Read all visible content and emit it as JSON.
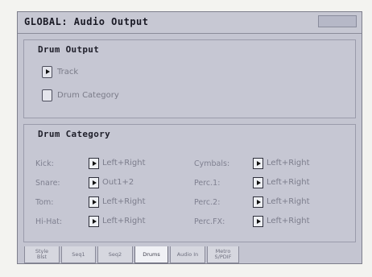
{
  "window": {
    "title": "GLOBAL: Audio Output"
  },
  "drum_output": {
    "heading": "Drum Output",
    "options": [
      {
        "label": "Track",
        "selected": true
      },
      {
        "label": "Drum Category",
        "selected": false
      }
    ]
  },
  "drum_category": {
    "heading": "Drum Category",
    "left": [
      {
        "label": "Kick:",
        "value": "Left+Right"
      },
      {
        "label": "Snare:",
        "value": "Out1+2"
      },
      {
        "label": "Tom:",
        "value": "Left+Right"
      },
      {
        "label": "Hi-Hat:",
        "value": "Left+Right"
      }
    ],
    "right": [
      {
        "label": "Cymbals:",
        "value": "Left+Right"
      },
      {
        "label": "Perc.1:",
        "value": "Left+Right"
      },
      {
        "label": "Perc.2:",
        "value": "Left+Right"
      },
      {
        "label": "Perc.FX:",
        "value": "Left+Right"
      }
    ]
  },
  "tabs": [
    {
      "line1": "Style",
      "line2": "Blst",
      "active": false
    },
    {
      "line1": "Seq1",
      "line2": "",
      "active": false
    },
    {
      "line1": "Seq2",
      "line2": "",
      "active": false
    },
    {
      "line1": "Drums",
      "line2": "",
      "active": true
    },
    {
      "line1": "Audio In",
      "line2": "",
      "active": false
    },
    {
      "line1": "Metro",
      "line2": "S/PDIF",
      "active": false
    }
  ],
  "colors": {
    "screen_bg": "#c4c5d1",
    "label_gray": "#7f8090"
  }
}
